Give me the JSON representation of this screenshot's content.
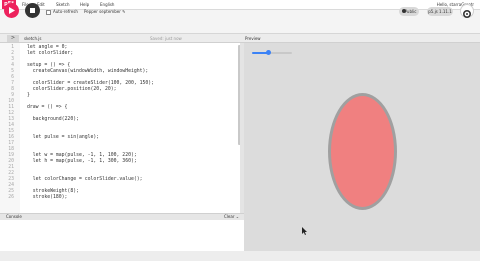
{
  "menubar": {
    "logo": "p5*",
    "items": [
      "File",
      "Edit",
      "Sketch",
      "Help",
      "English"
    ],
    "greeting": "Hello, starraGreatr"
  },
  "toolbar": {
    "auto_refresh_label": "Auto-refresh",
    "sketch_name": "Pepper september ✎",
    "public_label": "Public",
    "version_label": "p5.js 1.11.1"
  },
  "tabs": {
    "collapse": ">",
    "file": "sketch.js",
    "saved": "Saved: just now",
    "preview": "Preview"
  },
  "code_lines": [
    "let angle = 0;",
    "let colorSlider;",
    "",
    "setup = () => {",
    "  createCanvas(windowWidth, windowHeight);",
    "",
    "  colorSlider = createSlider(100, 200, 150);",
    "  colorSlider.position(20, 20);",
    "}",
    "",
    "draw = () => {",
    "",
    "  background(220);",
    "",
    "",
    "  let pulse = sin(angle);",
    "",
    "",
    "  let w = map(pulse, -1, 1, 100, 220);",
    "  let h = map(pulse, -1, 1, 300, 360);",
    "",
    "",
    "  let colorChange = colorSlider.value();",
    "",
    "  strokeWeight(8);",
    "  stroke(180);"
  ],
  "line_numbers": [
    "1",
    "2",
    "3",
    "4",
    "5",
    "6",
    "7",
    "8",
    "9",
    "10",
    "11",
    "12",
    "13",
    "14",
    "15",
    "16",
    "17",
    "18",
    "19",
    "20",
    "21",
    "22",
    "23",
    "24",
    "25",
    "26"
  ],
  "console": {
    "label": "Console",
    "clear": "Clear ⌄"
  },
  "preview": {
    "slider_value": 0.4,
    "ellipse_fill": "#f08080",
    "ellipse_stroke": "#a0a0a0",
    "background": "#dcdcdc"
  },
  "colors": {
    "accent": "#ed225d",
    "slider": "#3b82f6"
  }
}
